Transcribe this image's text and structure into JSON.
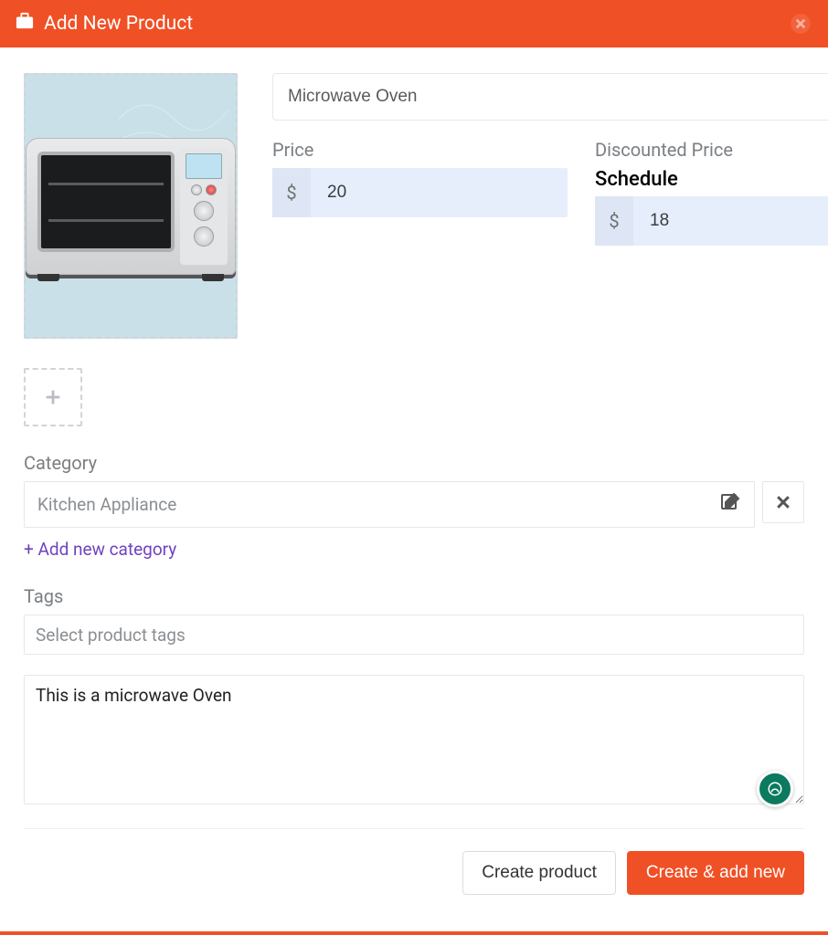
{
  "header": {
    "title": "Add New Product"
  },
  "fields": {
    "product_name": "Microwave Oven",
    "price_label": "Price",
    "price_value": "20",
    "discounted_label": "Discounted Price",
    "schedule_label": "Schedule",
    "discounted_value": "18",
    "currency_symbol": "$"
  },
  "category": {
    "label": "Category",
    "selected": "Kitchen Appliance",
    "add_link": "+ Add new category"
  },
  "tags": {
    "label": "Tags",
    "placeholder": "Select product tags"
  },
  "description": {
    "value": "This is a microwave Oven"
  },
  "footer": {
    "create": "Create product",
    "create_add": "Create & add new"
  }
}
